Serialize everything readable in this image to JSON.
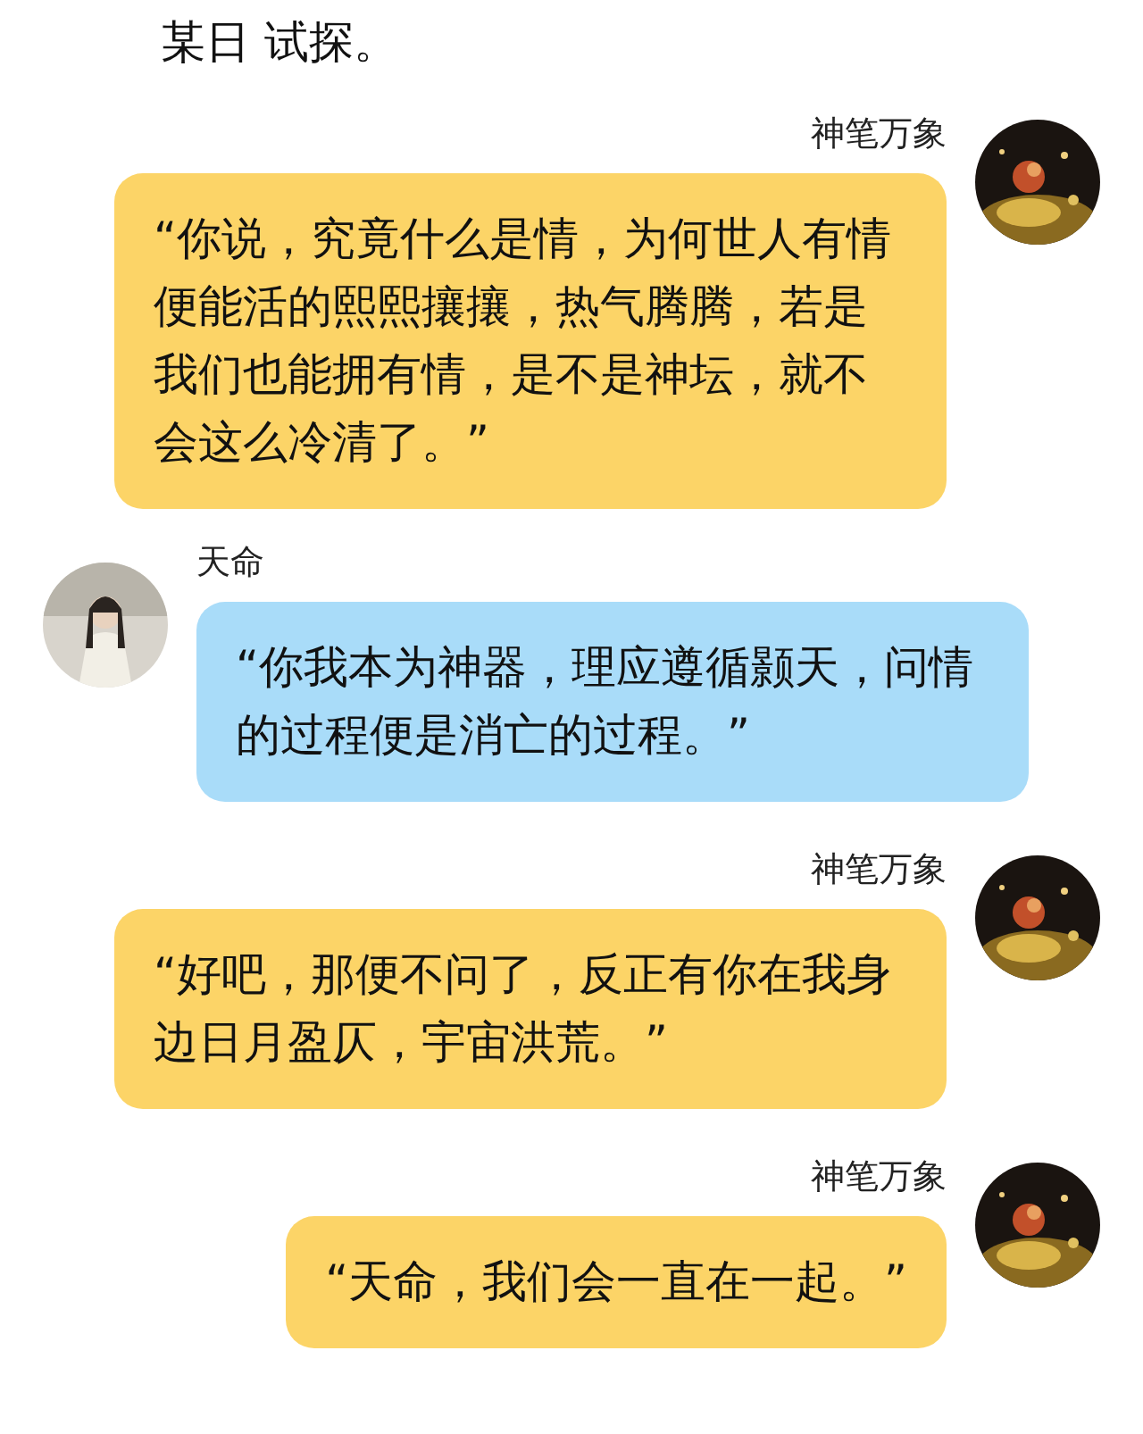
{
  "header": "某日 试探。",
  "messages": [
    {
      "kind": "outgoing",
      "sender": "神笔万象",
      "text": "“你说，究竟什么是情，为何世人有情便能活的熙熙攘攘，热气腾腾，若是我们也能拥有情，是不是神坛，就不会这么冷清了。”"
    },
    {
      "kind": "incoming",
      "sender": "天命",
      "text": "“你我本为神器，理应遵循颢天，问情的过程便是消亡的过程。”"
    },
    {
      "kind": "outgoing",
      "sender": "神笔万象",
      "text": "“好吧，那便不问了，反正有你在我身边日月盈仄，宇宙洪荒。”"
    },
    {
      "kind": "outgoing",
      "sender": "神笔万象",
      "text": "“天命，我们会一直在一起。”"
    }
  ]
}
